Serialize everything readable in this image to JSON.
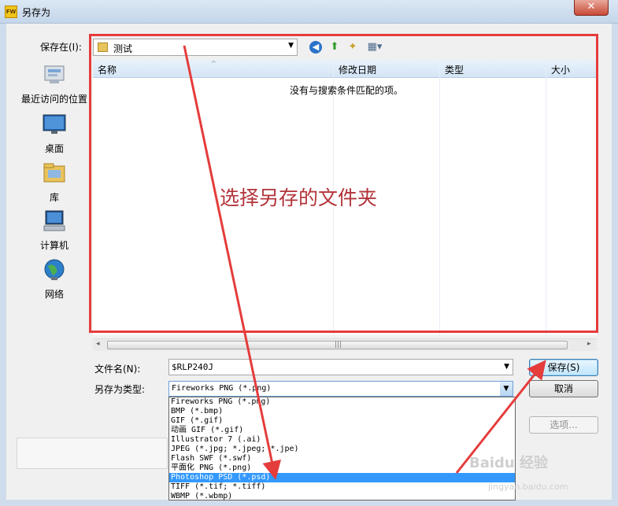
{
  "window": {
    "title": "另存为",
    "app_icon_text": "FW",
    "close": "✕"
  },
  "save_in": {
    "label": "保存在(I):",
    "value": "测试"
  },
  "toolbar": {
    "back": "back-icon",
    "up": "up-folder-icon",
    "new_folder": "new-folder-icon",
    "views": "views-menu-icon"
  },
  "places": [
    {
      "label": "最近访问的位置",
      "icon": "recent-places-icon"
    },
    {
      "label": "桌面",
      "icon": "desktop-icon"
    },
    {
      "label": "库",
      "icon": "libraries-icon"
    },
    {
      "label": "计算机",
      "icon": "computer-icon"
    },
    {
      "label": "网络",
      "icon": "network-icon"
    }
  ],
  "columns": [
    "名称",
    "修改日期",
    "类型",
    "大小"
  ],
  "empty_message": "没有与搜索条件匹配的项。",
  "annotation": "选择另存的文件夹",
  "file_name": {
    "label": "文件名(N):",
    "value": "$RLP240J"
  },
  "file_type": {
    "label": "另存为类型:",
    "value": "Fireworks PNG (*.png)",
    "options": [
      "Fireworks PNG (*.png)",
      "BMP (*.bmp)",
      "GIF (*.gif)",
      "动画 GIF (*.gif)",
      "Illustrator 7 (.ai)",
      "JPEG (*.jpg; *.jpeg; *.jpe)",
      "Flash SWF (*.swf)",
      "平面化 PNG (*.png)",
      "Photoshop PSD (*.psd)",
      "TIFF (*.tif; *.tiff)",
      "WBMP (*.wbmp)"
    ],
    "selected_index": 8
  },
  "buttons": {
    "save": "保存(S)",
    "cancel": "取消",
    "options": "选项..."
  },
  "watermark": {
    "brand": "Baidu 经验",
    "url": "jingyan.baidu.com"
  },
  "colors": {
    "annotation_red": "#e53c3c",
    "selection_blue": "#3399ff"
  }
}
